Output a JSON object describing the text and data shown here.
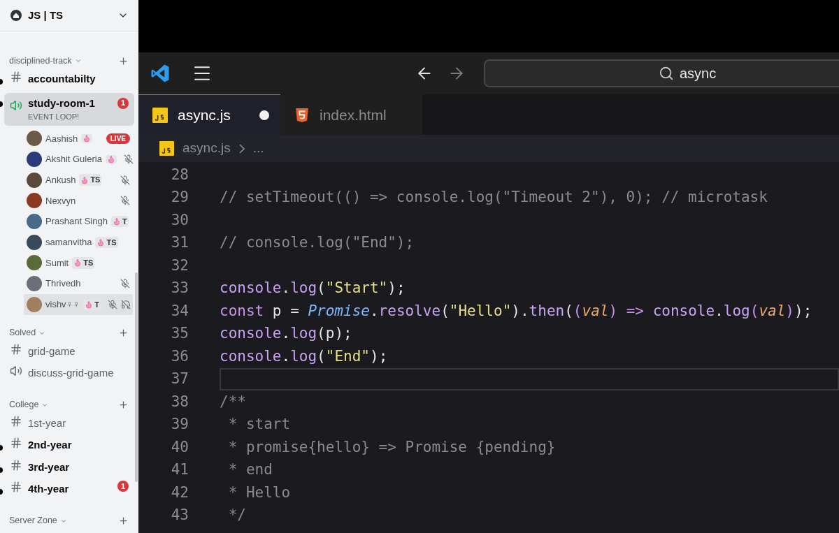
{
  "server": {
    "name": "JS | TS"
  },
  "categories": [
    {
      "name": "disciplined-track",
      "channels": [
        {
          "kind": "text",
          "name": "accountabilty",
          "unread": true,
          "selected": false
        },
        {
          "kind": "voice",
          "name": "study-room-1",
          "status": "EVENT LOOP!",
          "unread": true,
          "selected": true,
          "badge": "1",
          "members": [
            {
              "name": "Aashish",
              "tag": true,
              "live": "LIVE",
              "muted": false,
              "deafened": false,
              "selected": false,
              "color": "#6b5a48"
            },
            {
              "name": "Akshit Guleria",
              "tag": true,
              "muted": true,
              "deafened": false,
              "selected": false,
              "color": "#2a3a7a"
            },
            {
              "name": "Ankush",
              "tag": true,
              "tag_text": "TS",
              "muted": true,
              "deafened": false,
              "selected": false,
              "color": "#5a4a3a"
            },
            {
              "name": "Nexvyn",
              "tag": false,
              "muted": true,
              "deafened": false,
              "selected": false,
              "color": "#8a3a20"
            },
            {
              "name": "Prashant Singh",
              "tag": true,
              "tag_text": "T",
              "muted": false,
              "deafened": false,
              "selected": false,
              "color": "#4a6a8a"
            },
            {
              "name": "samanvitha",
              "tag": true,
              "tag_text": "TS",
              "muted": false,
              "deafened": false,
              "selected": false,
              "color": "#3a4a5a"
            },
            {
              "name": "Sumit",
              "tag": true,
              "tag_text": "TS",
              "muted": false,
              "deafened": false,
              "selected": false,
              "color": "#5a6a3a"
            },
            {
              "name": "Thrivedh",
              "tag": false,
              "muted": true,
              "deafened": false,
              "selected": false,
              "color": "#6d6f78"
            },
            {
              "name": "vishv♀︎♀︎",
              "tag": true,
              "tag_text": "T",
              "muted": true,
              "deafened": true,
              "selected": true,
              "color": "#a08060"
            }
          ]
        }
      ]
    },
    {
      "name": "Solved",
      "channels": [
        {
          "kind": "text",
          "name": "grid-game",
          "unread": false,
          "selected": false
        },
        {
          "kind": "voice",
          "name": "discuss-grid-game",
          "unread": false,
          "selected": false
        }
      ]
    },
    {
      "name": "College",
      "channels": [
        {
          "kind": "text",
          "name": "1st-year",
          "unread": false,
          "selected": false
        },
        {
          "kind": "text",
          "name": "2nd-year",
          "unread": true,
          "selected": false
        },
        {
          "kind": "text",
          "name": "3rd-year",
          "unread": true,
          "selected": false
        },
        {
          "kind": "text",
          "name": "4th-year",
          "unread": true,
          "selected": false,
          "badge": "1"
        }
      ]
    },
    {
      "name": "Server Zone"
    }
  ],
  "editor": {
    "search": {
      "value": "async"
    },
    "tabs": [
      {
        "label": "async.js",
        "kind": "js",
        "selected": true,
        "modified": true
      },
      {
        "label": "index.html",
        "kind": "html",
        "selected": false,
        "modified": false
      }
    ],
    "breadcrumb": {
      "file": "async.js",
      "more": "..."
    },
    "lines": [
      {
        "number": "28",
        "current": false
      },
      {
        "number": "29",
        "current": false,
        "tokens": [
          {
            "kind": "comment",
            "text": "// setTimeout(() => console.log(\"Timeout 2\"), 0); // microtask"
          }
        ]
      },
      {
        "number": "30",
        "current": false
      },
      {
        "number": "31",
        "current": false,
        "tokens": [
          {
            "kind": "comment",
            "text": "// console.log(\"End\");"
          }
        ]
      },
      {
        "number": "32",
        "current": false
      },
      {
        "number": "33",
        "current": false,
        "tokens": [
          {
            "kind": "fn",
            "text": "console"
          },
          {
            "kind": "plain",
            "text": "."
          },
          {
            "kind": "fn",
            "text": "log"
          },
          {
            "kind": "plain",
            "text": "("
          },
          {
            "kind": "str",
            "text": "\"Start\""
          },
          {
            "kind": "plain",
            "text": ");"
          }
        ]
      },
      {
        "number": "34",
        "current": false,
        "tokens": [
          {
            "kind": "kw",
            "text": "const"
          },
          {
            "kind": "plain",
            "text": " p = "
          },
          {
            "kind": "cls",
            "text": "Promise"
          },
          {
            "kind": "plain",
            "text": "."
          },
          {
            "kind": "fn",
            "text": "resolve"
          },
          {
            "kind": "plain",
            "text": "("
          },
          {
            "kind": "str",
            "text": "\"Hello\""
          },
          {
            "kind": "plain",
            "text": ")."
          },
          {
            "kind": "fn",
            "text": "then"
          },
          {
            "kind": "plain",
            "text": "("
          },
          {
            "kind": "kw",
            "text": "("
          },
          {
            "kind": "param",
            "text": "val"
          },
          {
            "kind": "kw",
            "text": ")"
          },
          {
            "kind": "kw",
            "text": " => "
          },
          {
            "kind": "fn",
            "text": "console"
          },
          {
            "kind": "plain",
            "text": "."
          },
          {
            "kind": "fn",
            "text": "log"
          },
          {
            "kind": "kw",
            "text": "("
          },
          {
            "kind": "param",
            "text": "val"
          },
          {
            "kind": "kw",
            "text": ")"
          },
          {
            "kind": "plain",
            "text": ");"
          }
        ]
      },
      {
        "number": "35",
        "current": false,
        "tokens": [
          {
            "kind": "fn",
            "text": "console"
          },
          {
            "kind": "plain",
            "text": "."
          },
          {
            "kind": "fn",
            "text": "log"
          },
          {
            "kind": "plain",
            "text": "(p);"
          }
        ]
      },
      {
        "number": "36",
        "current": false,
        "tokens": [
          {
            "kind": "fn",
            "text": "console"
          },
          {
            "kind": "plain",
            "text": "."
          },
          {
            "kind": "fn",
            "text": "log"
          },
          {
            "kind": "plain",
            "text": "("
          },
          {
            "kind": "str",
            "text": "\"End\""
          },
          {
            "kind": "plain",
            "text": ");"
          }
        ]
      },
      {
        "number": "37",
        "current": true
      },
      {
        "number": "38",
        "current": false,
        "tokens": [
          {
            "kind": "comment",
            "text": "/**"
          }
        ]
      },
      {
        "number": "39",
        "current": false,
        "tokens": [
          {
            "kind": "comment",
            "text": " * start"
          }
        ]
      },
      {
        "number": "40",
        "current": false,
        "tokens": [
          {
            "kind": "comment",
            "text": " * promise{hello} => Promise {pending}"
          }
        ]
      },
      {
        "number": "41",
        "current": false,
        "tokens": [
          {
            "kind": "comment",
            "text": " * end"
          }
        ]
      },
      {
        "number": "42",
        "current": false,
        "tokens": [
          {
            "kind": "comment",
            "text": " * Hello"
          }
        ]
      },
      {
        "number": "43",
        "current": false,
        "tokens": [
          {
            "kind": "comment",
            "text": " */"
          }
        ]
      }
    ]
  }
}
